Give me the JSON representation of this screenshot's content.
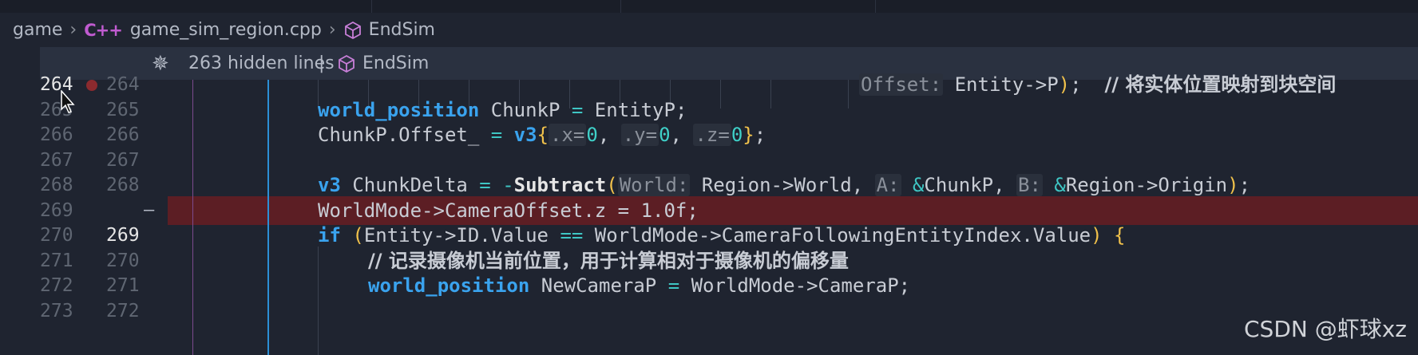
{
  "breadcrumb": {
    "folder": "game",
    "file_icon": "C++",
    "file": "game_sim_region.cpp",
    "symbol": "EndSim"
  },
  "sticky": {
    "hidden_lines": "263 hidden lines",
    "separator": "|",
    "symbol": "EndSim"
  },
  "gutter": {
    "old_numbers": [
      "264",
      "265",
      "266",
      "267",
      "268",
      "269",
      "270",
      "271",
      "272",
      "273"
    ],
    "new_numbers": [
      "264",
      "265",
      "266",
      "267",
      "268",
      "",
      "269",
      "270",
      "271",
      "272"
    ],
    "deleted_marker": "—"
  },
  "code": {
    "l264": {
      "hint": "Offset:",
      "text": "Entity->P",
      "close": ")",
      "semi": ";",
      "comment": "// 将实体位置映射到块空间"
    },
    "l265": {
      "type": "world_position",
      "name": " ChunkP ",
      "eq": "=",
      "rest": " EntityP;"
    },
    "l266": {
      "a": "ChunkP.Offset_ ",
      "eq": "=",
      "type": "v3",
      "ob": "{",
      "hx": ".x=",
      "x": "0",
      "c1": ", ",
      "hy": ".y=",
      "y": "0",
      "c2": ", ",
      "hz": ".z=",
      "z": "0",
      "cb": "}",
      "semi": ";"
    },
    "l268": {
      "type": "v3",
      "name": " ChunkDelta ",
      "eq": "=",
      "neg": " -",
      "fn": "Subtract",
      "op": "(",
      "h1": "World:",
      "a1": " Region->World, ",
      "h2": "A:",
      "amp1": " &",
      "a2": "ChunkP, ",
      "h3": "B:",
      "amp2": " &",
      "a3": "Region->Origin",
      "cp": ")",
      "semi": ";"
    },
    "l269": {
      "text": "WorldMode->CameraOffset.z = 1.0f;"
    },
    "l270": {
      "kw": "if",
      "op": " (",
      "a": "Entity->ID.Value ",
      "eq": "==",
      "b": " WorldMode->CameraFollowingEntityIndex.Value",
      "cp": ")",
      "ob": " {"
    },
    "l271": {
      "comment": "// 记录摄像机当前位置，用于计算相对于摄像机的偏移量"
    },
    "l272": {
      "type": "world_position",
      "name": " NewCameraP ",
      "eq": "=",
      "rest": " WorldMode->CameraP;"
    }
  },
  "watermark": "CSDN @虾球xz",
  "icons": {
    "cpp": "cpp-file-icon",
    "cube": "symbol-method-icon",
    "unfold": "unfold-icon",
    "breakpoint": "breakpoint-icon",
    "cursor": "mouse-cursor-icon"
  },
  "colors": {
    "background": "#1f2430",
    "deleted_line": "#5c1e24",
    "keyword": "#3aa3ee",
    "number": "#3fd0c8",
    "bracket_yellow": "#f0c14b",
    "bracket_purple": "#c87fd8",
    "breakpoint": "#8b2a2e"
  }
}
